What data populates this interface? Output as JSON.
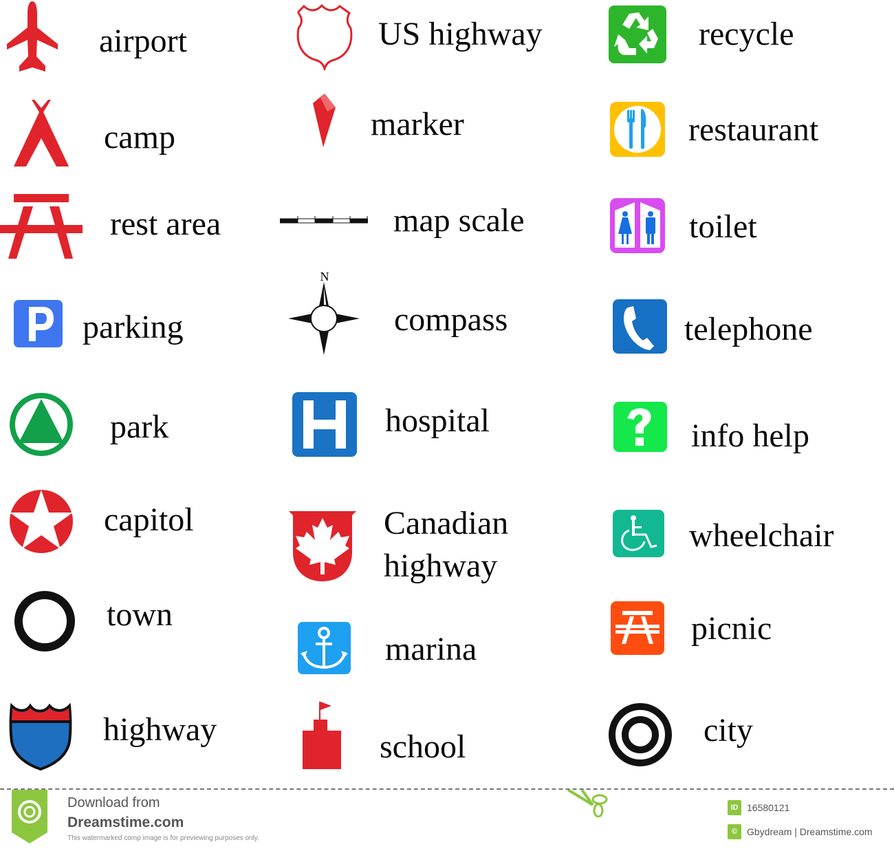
{
  "legend": {
    "column1": [
      {
        "id": "airport",
        "label": "airport",
        "icon": "airplane-icon",
        "color": "#e0242b"
      },
      {
        "id": "camp",
        "label": "camp",
        "icon": "tent-icon",
        "color": "#e0242b"
      },
      {
        "id": "rest-area",
        "label": "rest area",
        "icon": "picnic-table-icon",
        "color": "#e0242b"
      },
      {
        "id": "parking",
        "label": "parking",
        "icon": "parking-p-icon",
        "color": "#3f76f0"
      },
      {
        "id": "park",
        "label": "park",
        "icon": "triangle-in-circle-icon",
        "color": "#12a04a"
      },
      {
        "id": "capitol",
        "label": "capitol",
        "icon": "star-in-circle-icon",
        "color": "#e0242b"
      },
      {
        "id": "town",
        "label": "town",
        "icon": "ring-icon",
        "color": "#111111"
      },
      {
        "id": "highway",
        "label": "highway",
        "icon": "interstate-shield-icon",
        "colors": [
          "#e0242b",
          "#1e6fc0"
        ]
      }
    ],
    "column2": [
      {
        "id": "us-highway",
        "label": "US highway",
        "icon": "us-shield-outline-icon",
        "color": "#e0242b"
      },
      {
        "id": "marker",
        "label": "marker",
        "icon": "marker-pin-icon",
        "color": "#e0242b"
      },
      {
        "id": "map-scale",
        "label": "map scale",
        "icon": "scale-bar-icon",
        "color": "#111111"
      },
      {
        "id": "compass",
        "label": "compass",
        "icon": "compass-rose-icon",
        "color": "#111111",
        "north": "N"
      },
      {
        "id": "hospital",
        "label": "hospital",
        "icon": "hospital-h-icon",
        "color": "#1a73c4"
      },
      {
        "id": "canadian-highway",
        "label_line1": "Canadian",
        "label_line2": "highway",
        "icon": "maple-leaf-shield-icon",
        "color": "#e0242b"
      },
      {
        "id": "marina",
        "label": "marina",
        "icon": "anchor-icon",
        "color": "#1ea0f0"
      },
      {
        "id": "school",
        "label": "school",
        "icon": "school-flag-icon",
        "color": "#e0242b"
      }
    ],
    "column3": [
      {
        "id": "recycle",
        "label": "recycle",
        "icon": "recycle-icon",
        "color": "#2db52b"
      },
      {
        "id": "restaurant",
        "label": "restaurant",
        "icon": "fork-knife-icon",
        "color": "#ffc000"
      },
      {
        "id": "toilet",
        "label": "toilet",
        "icon": "restroom-icon",
        "color": "#d94cf0"
      },
      {
        "id": "telephone",
        "label": "telephone",
        "icon": "phone-icon",
        "color": "#1670c4"
      },
      {
        "id": "info-help",
        "label": "info help",
        "icon": "question-mark-icon",
        "color": "#14e84a"
      },
      {
        "id": "wheelchair",
        "label": "wheelchair",
        "icon": "wheelchair-icon",
        "color": "#12b892"
      },
      {
        "id": "picnic",
        "label": "picnic",
        "icon": "picnic-table-icon",
        "color": "#ff4d12"
      },
      {
        "id": "city",
        "label": "city",
        "icon": "double-ring-icon",
        "color": "#111111"
      }
    ]
  },
  "footer": {
    "download_from": "Download from",
    "brand": "Dreamstime.com",
    "note": "This watermarked comp image is for previewing purposes only.",
    "id_badge": "ID",
    "image_id": "16580121",
    "copyright_symbol": "©",
    "credit": "Gbydream | Dreamstime.com",
    "accent": "#8cc63f"
  }
}
